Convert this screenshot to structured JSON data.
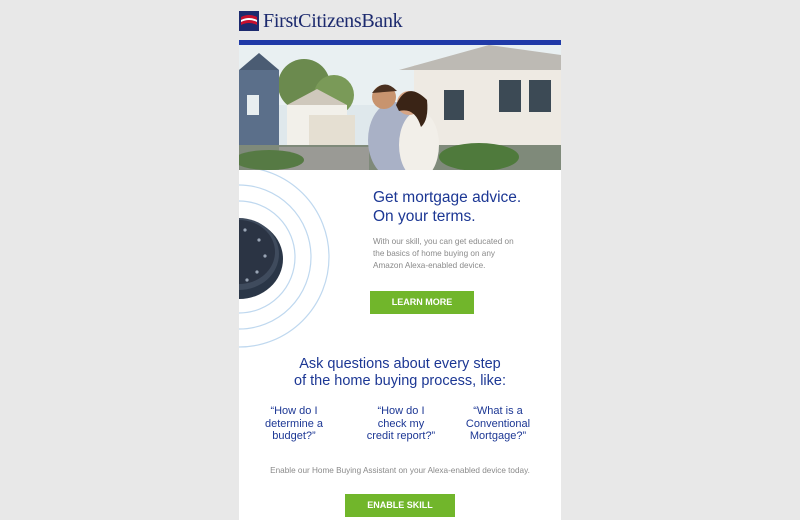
{
  "brand": {
    "name": "FirstCitizensBank",
    "primary_color": "#1c2a6e",
    "accent_color": "#1f3aa8",
    "cta_color": "#71b62b"
  },
  "hero": {
    "icon": "couple-house-photo"
  },
  "promo": {
    "title_line1": "Get mortgage advice.",
    "title_line2": "On your terms.",
    "body": "With our skill, you can get educated on the basics of home buying on any Amazon Alexa-enabled device.",
    "button_label": "LEARN MORE",
    "device_icon": "echo-dot-icon"
  },
  "ask": {
    "title_line1": "Ask questions about every step",
    "title_line2": "of the home buying process, like:",
    "questions": [
      {
        "line1": "“How do I",
        "line2": "determine a",
        "line3": "budget?”"
      },
      {
        "line1": "“How do I",
        "line2": "check my",
        "line3": "credit report?”"
      },
      {
        "line1": "“What is a",
        "line2": "Conventional",
        "line3": "Mortgage?”"
      }
    ]
  },
  "enable": {
    "text": "Enable our Home Buying Assistant on your Alexa-enabled device today.",
    "button_label": "ENABLE SKILL"
  }
}
